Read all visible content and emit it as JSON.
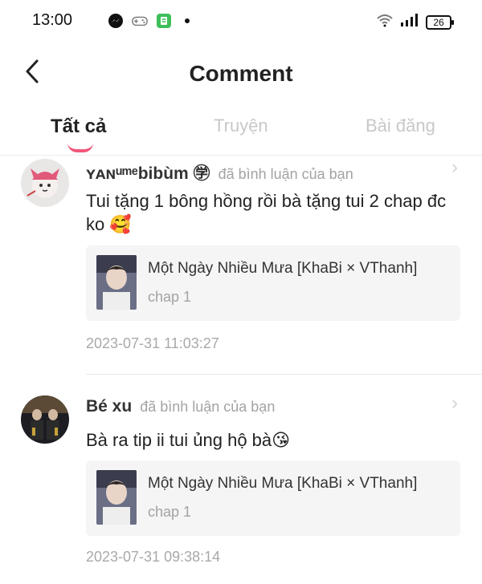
{
  "status_bar": {
    "time": "13:00",
    "battery": "26",
    "icons": [
      "messenger-icon",
      "gamepad-icon",
      "app-icon",
      "dot-icon",
      "wifi-icon",
      "signal-icon",
      "battery-icon"
    ]
  },
  "header": {
    "title": "Comment",
    "back_icon": "chevron-left-icon"
  },
  "tabs": [
    {
      "label": "Tất cả",
      "active": true
    },
    {
      "label": "Truyện",
      "active": false
    },
    {
      "label": "Bài đăng",
      "active": false
    }
  ],
  "comments": [
    {
      "username": "ʏᴀɴᵘᵐᵉbibùm ㊫",
      "action": "đã bình luận của bạn",
      "text": "Tui tặng 1 bông hồng rồi bà tặng tui 2 chap đc ko",
      "emoji": "🥰",
      "card_title": "Một Ngày Nhiều Mưa [KhaBi × VThanh]",
      "card_chapter": "chap 1",
      "timestamp": "2023-07-31 11:03:27"
    },
    {
      "username": "Bé xu",
      "action": "đã bình luận của bạn",
      "text": "Bà ra tip ii tui ủng hộ bà",
      "emoji": "😘",
      "card_title": "Một Ngày Nhiều Mưa [KhaBi × VThanh]",
      "card_chapter": "chap 1",
      "timestamp": "2023-07-31 09:38:14"
    }
  ],
  "colors": {
    "accent": "#f2557a",
    "muted_text": "#a3a3a3",
    "card_bg": "#f5f5f5"
  }
}
